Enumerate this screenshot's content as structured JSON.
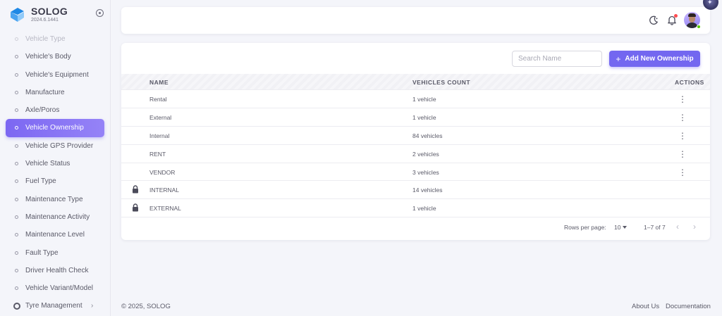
{
  "brand": {
    "name": "SOLOG",
    "version": "2024.6.1441"
  },
  "sidebar": {
    "items": [
      {
        "label": "Vehicle Type",
        "state": "faded"
      },
      {
        "label": "Vehicle's Body",
        "state": ""
      },
      {
        "label": "Vehicle's Equipment",
        "state": ""
      },
      {
        "label": "Manufacture",
        "state": ""
      },
      {
        "label": "Axle/Poros",
        "state": ""
      },
      {
        "label": "Vehicle Ownership",
        "state": "active"
      },
      {
        "label": "Vehicle GPS Provider",
        "state": ""
      },
      {
        "label": "Vehicle Status",
        "state": ""
      },
      {
        "label": "Fuel Type",
        "state": ""
      },
      {
        "label": "Maintenance Type",
        "state": ""
      },
      {
        "label": "Maintenance Activity",
        "state": ""
      },
      {
        "label": "Maintenance Level",
        "state": ""
      },
      {
        "label": "Fault Type",
        "state": ""
      },
      {
        "label": "Driver Health Check",
        "state": ""
      },
      {
        "label": "Vehicle Variant/Model",
        "state": ""
      }
    ],
    "group": {
      "label": "Tyre Management",
      "icon": "circle-ring-icon"
    }
  },
  "toolbar": {
    "search_placeholder": "Search Name",
    "add_label": "Add New Ownership",
    "add_icon": "plus-icon"
  },
  "table": {
    "columns": {
      "name": "NAME",
      "count": "VEHICLES COUNT",
      "actions": "ACTIONS"
    },
    "rows": [
      {
        "name": "Rental",
        "count": "1 vehicle",
        "locked": false,
        "actions": true
      },
      {
        "name": "External",
        "count": "1 vehicle",
        "locked": false,
        "actions": true
      },
      {
        "name": "Internal",
        "count": "84 vehicles",
        "locked": false,
        "actions": true
      },
      {
        "name": "RENT",
        "count": "2 vehicles",
        "locked": false,
        "actions": true
      },
      {
        "name": "VENDOR",
        "count": "3 vehicles",
        "locked": false,
        "actions": true
      },
      {
        "name": "INTERNAL",
        "count": "14 vehicles",
        "locked": true,
        "actions": false
      },
      {
        "name": "EXTERNAL",
        "count": "1 vehicle",
        "locked": true,
        "actions": false
      }
    ]
  },
  "pagination": {
    "rows_per_page_label": "Rows per page:",
    "rows_per_page": "10",
    "range": "1–7 of 7"
  },
  "footer": {
    "copyright": "© 2025, SOLOG",
    "about": "About Us",
    "documentation": "Documentation"
  },
  "colors": {
    "primary": "#7367f0",
    "badge": "#ff4c51",
    "online": "#56ca00"
  }
}
